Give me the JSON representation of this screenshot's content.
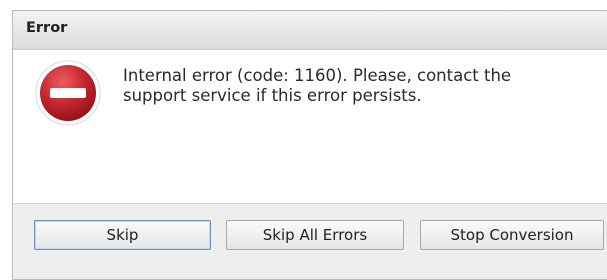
{
  "window": {
    "title": "Error"
  },
  "message": {
    "line1": "Internal error (code: 1160). Please, contact the",
    "line2": "support service if this error persists."
  },
  "icons": {
    "status": "error-stop-icon"
  },
  "buttons": {
    "skip": "Skip",
    "skip_all": "Skip All Errors",
    "stop": "Stop Conversion"
  },
  "colors": {
    "icon_red": "#c3262c",
    "icon_dark_red": "#8e1116",
    "default_button_border": "#6f8fbf"
  }
}
